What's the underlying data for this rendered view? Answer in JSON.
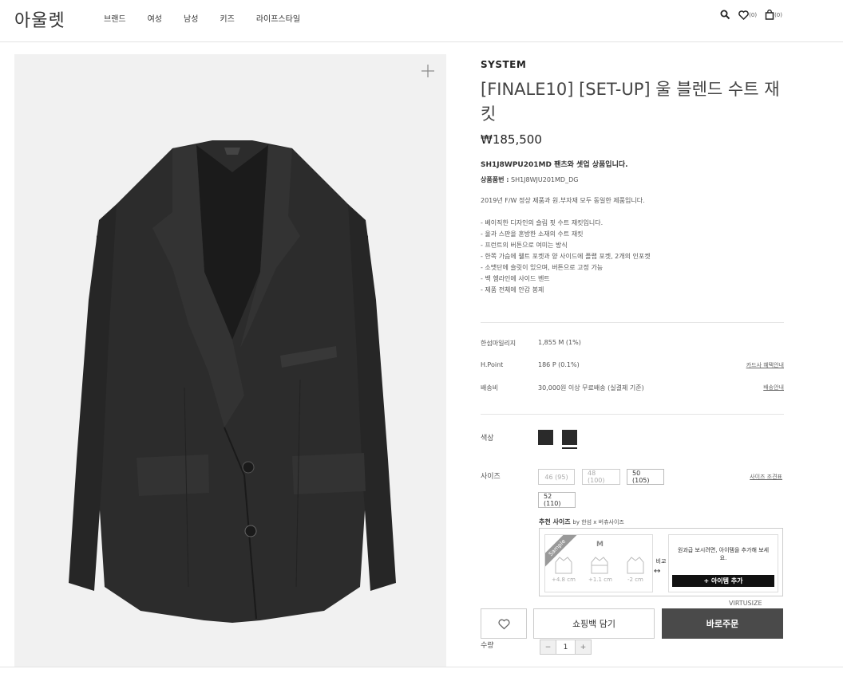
{
  "header": {
    "logo": "아울렛",
    "nav": [
      "브랜드",
      "여성",
      "남성",
      "키즈",
      "라이프스타일"
    ],
    "wishlist_count": "(0)",
    "cart_count": "(0)"
  },
  "product": {
    "brand": "SYSTEM",
    "title": "[FINALE10] [SET-UP] 울 블렌드 수트 재킷",
    "price": "₩185,500",
    "setup_note": "SH1J8WPU201MD 팬츠와 셋업 상품입니다.",
    "code_label": "상품품번 :",
    "code_value": "SH1J8WJU201MD_DG",
    "desc_intro": "2019년 F/W 정상 제품과 원.부자재 모두 동일한 제품입니다.",
    "desc_lines": [
      "- 베이직한 디자인의 슬림 핏 수트 재킷입니다.",
      "- 울과 스판을 혼방한 소재의 수트 재킷",
      "- 프런트의 버튼으로 여미는 방식",
      "- 한쪽 가슴에 웰트 포켓과 양 사이드에 플랩 포켓, 2개의 인포켓",
      "- 소맷단에 슬릿이 있으며, 버튼으로 고정 가능",
      "- 백 헴라인에 사이드 벤트",
      "- 제품 전체에 안감 봉제"
    ]
  },
  "benefits": [
    {
      "label": "한섬마일리지",
      "value": "1,855 M (1%)",
      "link": ""
    },
    {
      "label": "H.Point",
      "value": "186 P (0.1%)",
      "link": "카드사 혜택안내"
    },
    {
      "label": "배송비",
      "value": "30,000원 이상 무료배송 (실결제 기준)",
      "link": "배송안내"
    }
  ],
  "color": {
    "label": "색상",
    "swatches": [
      "#2a2a2a",
      "#2a2a2a"
    ]
  },
  "size": {
    "label": "사이즈",
    "options": [
      "46 (95)",
      "48 (100)",
      "50 (105)",
      "52 (110)"
    ],
    "guide": "사이즈 조견표"
  },
  "virtusize": {
    "title": "추천 사이즈",
    "by": "by 한섬 x 버츄사이즈",
    "sample": "Sample",
    "size": "M",
    "diffs": [
      "+4.8 cm",
      "+1.1 cm",
      "-2 cm"
    ],
    "compare": "비교",
    "add_text": "원과급 보시려면, 아이템을 추가해 보세요.",
    "add_button": "+ 아이템 추가",
    "brand": "VIRTUSIZE"
  },
  "actions": {
    "cart": "쇼핑백 담기",
    "buy": "바로주문",
    "qty_label": "수량",
    "qty_value": "1",
    "minus": "−",
    "plus": "+"
  }
}
